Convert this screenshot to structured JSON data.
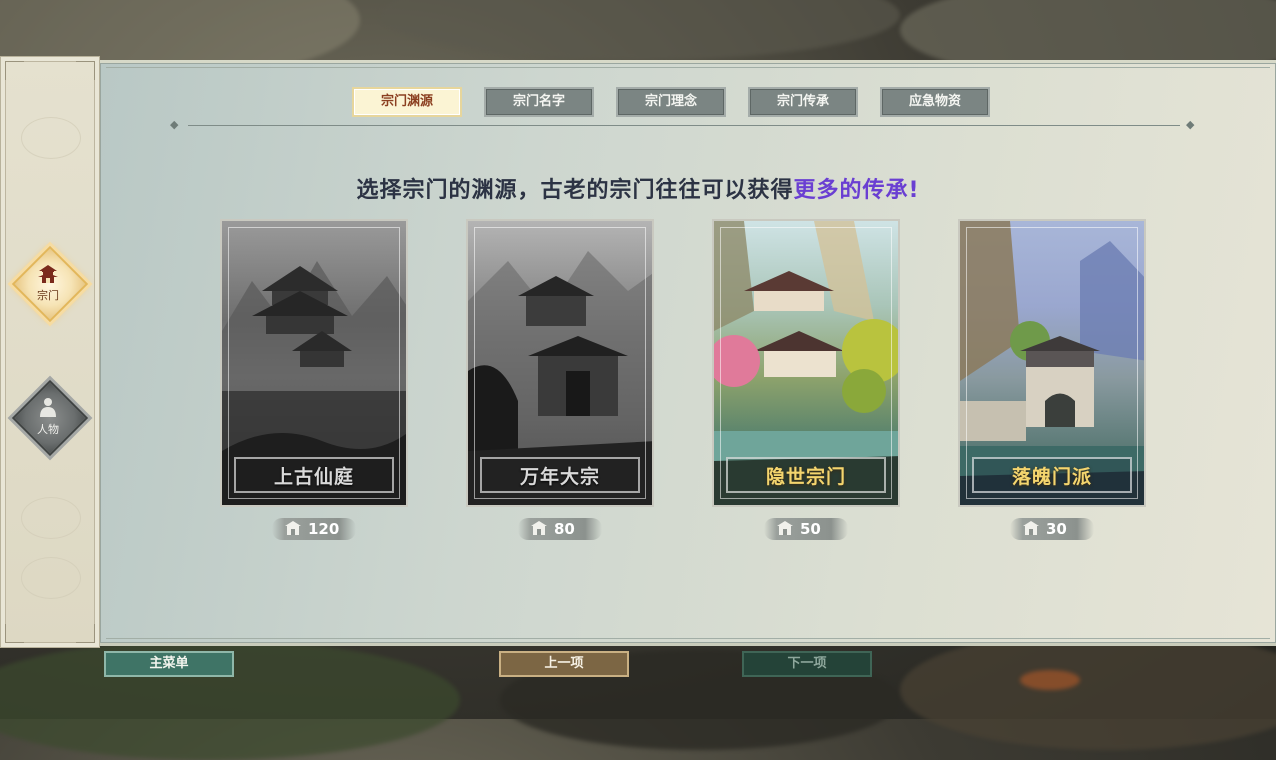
{
  "tabs": [
    {
      "label": "宗门渊源",
      "active": true
    },
    {
      "label": "宗门名字",
      "active": false
    },
    {
      "label": "宗门理念",
      "active": false
    },
    {
      "label": "宗门传承",
      "active": false
    },
    {
      "label": "应急物资",
      "active": false
    }
  ],
  "side_menu": [
    {
      "label": "宗门",
      "icon": "pavilion-icon",
      "active": true
    },
    {
      "label": "人物",
      "icon": "person-icon",
      "active": false
    }
  ],
  "headline": {
    "text": "选择宗门的渊源，古老的宗门往往可以获得",
    "highlight": "更多的传承!",
    "highlight_color": "#6a3fd2"
  },
  "cards": [
    {
      "title": "上古仙庭",
      "cost": "120",
      "style": "grayscale"
    },
    {
      "title": "万年大宗",
      "cost": "80",
      "style": "grayscale"
    },
    {
      "title": "隐世宗门",
      "cost": "50",
      "style": "color"
    },
    {
      "title": "落魄门派",
      "cost": "30",
      "style": "color"
    }
  ],
  "cost_icon": "temple-icon",
  "bottom": {
    "main_menu": "主菜单",
    "prev": "上一项",
    "next": "下一项"
  }
}
